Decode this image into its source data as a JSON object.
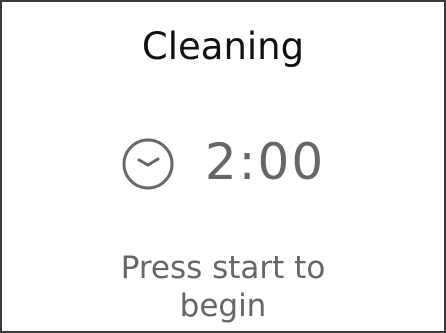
{
  "screen": {
    "title": "Cleaning",
    "timer": {
      "icon": "clock-icon",
      "value": "2:00"
    },
    "message": {
      "line1": "Press start to",
      "line2": "begin"
    }
  },
  "colors": {
    "border": "#3a3a3a",
    "title_text": "#111111",
    "secondary_text": "#666666",
    "background": "#ffffff"
  }
}
